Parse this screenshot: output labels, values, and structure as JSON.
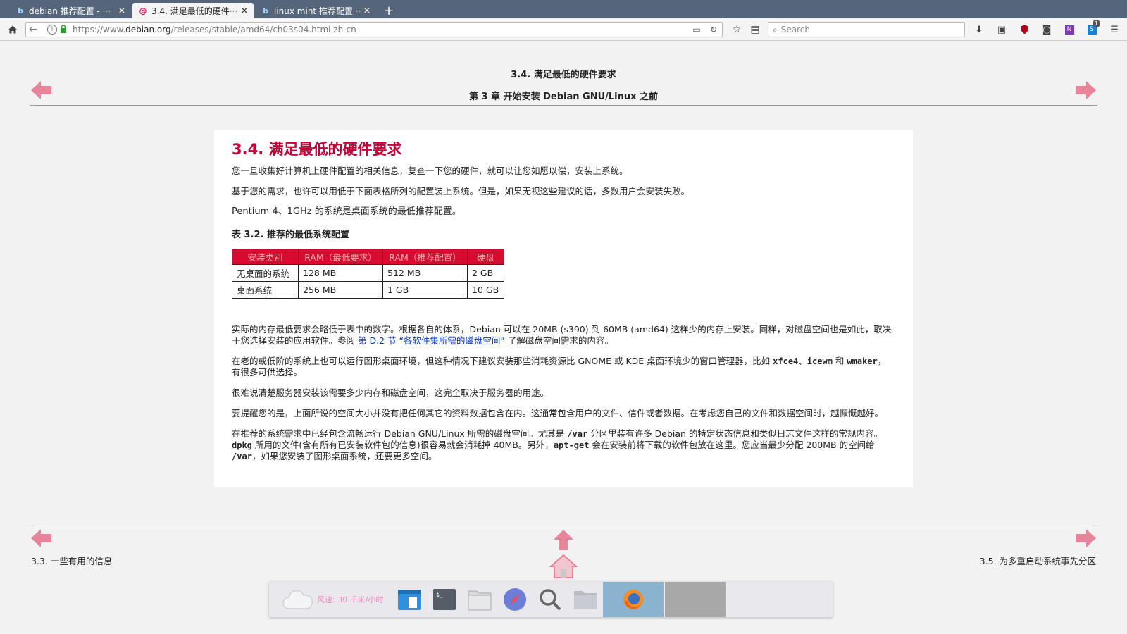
{
  "tabs": [
    {
      "label": "debian 推荐配置 - ···",
      "favicon": "b"
    },
    {
      "label": "3.4. 满足最低的硬件···",
      "favicon": "debian-swirl"
    },
    {
      "label": "linux mint 推荐配置 ···",
      "favicon": "b"
    }
  ],
  "navbar": {
    "url_prefix": "https://www.",
    "url_domain": "debian.org",
    "url_path": "/releases/stable/amd64/ch03s04.html.zh-cn",
    "search_placeholder": "Search",
    "ext_badge": "1"
  },
  "header": {
    "section_title": "3.4. 满足最低的硬件要求",
    "chapter_title": "第 3 章 开始安装 Debian GNU/Linux 之前"
  },
  "content": {
    "heading": "3.4. 满足最低的硬件要求",
    "p1": "您一旦收集好计算机上硬件配置的相关信息，复查一下您的硬件，就可以让您如愿以偿，安装上系统。",
    "p2": "基于您的需求，也许可以用低于下面表格所列的配置装上系统。但是，如果无视这些建议的话，多数用户会安装失败。",
    "p3": "Pentium 4、1GHz 的系统是桌面系统的最低推荐配置。",
    "table_caption": "表 3.2. 推荐的最低系统配置",
    "table": {
      "headers": [
        "安装类别",
        "RAM（最低要求）",
        "RAM（推荐配置）",
        "硬盘"
      ],
      "rows": [
        [
          "无桌面的系统",
          "128 MB",
          "512 MB",
          "2 GB"
        ],
        [
          "桌面系统",
          "256 MB",
          "1 GB",
          "10 GB"
        ]
      ]
    },
    "p4_a": "实际的内存最低要求会略低于表中的数字。根据各自的体系，Debian 可以在 20MB (s390) 到 60MB (amd64) 这样少的内存上安装。同样，对磁盘空间也是如此，取决于您选择安装的应用软件。参阅 ",
    "p4_link": "第 D.2 节 “各软件集所需的磁盘空间”",
    "p4_b": " 了解磁盘空间需求的内容。",
    "p5_a": "在老的或低阶的系统上也可以运行图形桌面环境，但这种情况下建议安装那些消耗资源比 GNOME 或 KDE 桌面环境少的窗口管理器，比如 ",
    "p5_code1": "xfce4",
    "p5_sep": "、",
    "p5_code2": "icewm",
    "p5_and": " 和 ",
    "p5_code3": "wmaker",
    "p5_b": "，有很多可供选择。",
    "p6": "很难说清楚服务器安装该需要多少内存和磁盘空间，这完全取决于服务器的用途。",
    "p7": "要提醒您的是，上面所说的空间大小并没有把任何其它的资料数据包含在内。这通常包含用户的文件、信件或者数据。在考虑您自己的文件和数据空间时，越慷慨越好。",
    "p8_a": "在推荐的系统需求中已经包含流畅运行 Debian GNU/Linux 所需的磁盘空间。尤其是 ",
    "p8_code1": "/var",
    "p8_b": " 分区里装有许多 Debian 的特定状态信息和类似日志文件这样的常规内容。",
    "p8_code2": "dpkg",
    "p8_c": " 所用的文件(含有所有已安装软件包的信息)很容易就会消耗掉 40MB。另外，",
    "p8_code3": "apt-get",
    "p8_d": " 会在安装前将下载的软件包放在这里。您应当最少分配 200MB 的空间给 ",
    "p8_code4": "/var",
    "p8_e": "，如果您安装了图形桌面系统，还要更多空间。"
  },
  "footer": {
    "prev_label": "3.3. 一些有用的信息",
    "next_label": "3.5. 为多重启动系统事先分区"
  },
  "dock": {
    "weather_text": "风速: 30 千米/小时"
  },
  "colors": {
    "tabbar_bg": "#55657a",
    "heading_red": "#c70036",
    "table_header_bg": "#d70a2f",
    "link_blue": "#0035c7",
    "nav_arrow_pink": "#e8849a"
  }
}
